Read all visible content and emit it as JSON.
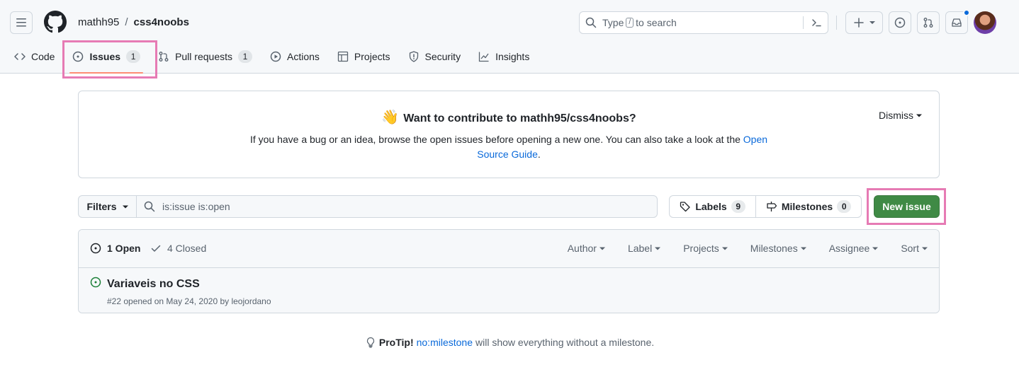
{
  "header": {
    "repo_owner": "mathh95",
    "repo_separator": "/",
    "repo_name": "css4noobs",
    "search": {
      "prefix": "Type",
      "key": "/",
      "suffix": "to search"
    },
    "icons": [
      "hamburger-icon",
      "github-logo-icon",
      "search-icon",
      "command-palette-icon",
      "plus-icon",
      "issues-icon",
      "pull-requests-icon",
      "inbox-icon"
    ]
  },
  "nav": {
    "tabs": [
      {
        "label": "Code",
        "icon": "code-icon"
      },
      {
        "label": "Issues",
        "icon": "issue-opened-icon",
        "count": "1",
        "selected": true
      },
      {
        "label": "Pull requests",
        "icon": "git-pull-request-icon",
        "count": "1"
      },
      {
        "label": "Actions",
        "icon": "play-icon"
      },
      {
        "label": "Projects",
        "icon": "table-icon"
      },
      {
        "label": "Security",
        "icon": "shield-icon"
      },
      {
        "label": "Insights",
        "icon": "graph-icon"
      }
    ]
  },
  "banner": {
    "emoji": "👋",
    "title": "Want to contribute to mathh95/css4noobs?",
    "text_before": "If you have a bug or an idea, browse the open issues before opening a new one. You can also take a look at the",
    "link": "Open Source Guide",
    "text_after": ".",
    "dismiss": "Dismiss"
  },
  "filters": {
    "button": "Filters",
    "query": "is:issue is:open",
    "labels": {
      "label": "Labels",
      "count": "9"
    },
    "milestones": {
      "label": "Milestones",
      "count": "0"
    },
    "new_issue": "New issue"
  },
  "issues": {
    "open_label": "1 Open",
    "closed_label": "4 Closed",
    "sort_menus": [
      "Author",
      "Label",
      "Projects",
      "Milestones",
      "Assignee",
      "Sort"
    ],
    "rows": [
      {
        "title": "Variaveis no CSS",
        "meta": "#22 opened on May 24, 2020 by leojordano"
      }
    ]
  },
  "protip": {
    "label": "ProTip!",
    "link": "no:milestone",
    "text": "will show everything without a milestone."
  },
  "colors": {
    "accent_blue": "#0969da",
    "success_green": "#3f8a45",
    "tab_underline": "#fd8c73",
    "annotation_highlight": "#e67bb4"
  }
}
